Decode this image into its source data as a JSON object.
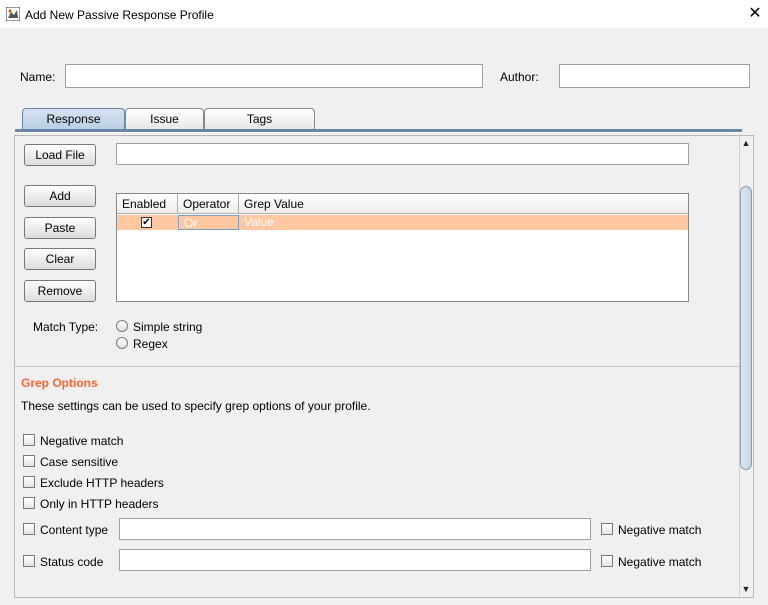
{
  "window": {
    "title": "Add New Passive Response Profile",
    "close_glyph": "✕",
    "icon": "burp-app-icon"
  },
  "header": {
    "name_label": "Name:",
    "name_value": "",
    "author_label": "Author:",
    "author_value": ""
  },
  "tabs": [
    {
      "label": "Response",
      "active": true
    },
    {
      "label": "Issue",
      "active": false
    },
    {
      "label": "Tags",
      "active": false
    }
  ],
  "response": {
    "load_file_label": "Load File",
    "load_file_path": "",
    "buttons": {
      "add": "Add",
      "paste": "Paste",
      "clear": "Clear",
      "remove": "Remove"
    },
    "table": {
      "columns": [
        "Enabled",
        "Operator",
        "Grep Value"
      ],
      "rows": [
        {
          "enabled": true,
          "operator": "Or",
          "grep_value": "Value"
        }
      ],
      "selected_row_color": "#ffc8a0"
    },
    "match_type": {
      "label": "Match Type:",
      "options": [
        "Simple string",
        "Regex"
      ],
      "selected": ""
    }
  },
  "grep_options": {
    "title": "Grep Options",
    "title_color": "#ff6633",
    "description": "These settings can be used to specify grep options of your profile.",
    "checkboxes": [
      {
        "label": "Negative match",
        "checked": false
      },
      {
        "label": "Case sensitive",
        "checked": false
      },
      {
        "label": "Exclude HTTP headers",
        "checked": false
      },
      {
        "label": "Only in HTTP headers",
        "checked": false
      }
    ],
    "content_type": {
      "label": "Content type",
      "value": "",
      "negative_label": "Negative match",
      "negative_checked": false
    },
    "status_code": {
      "label": "Status code",
      "value": "",
      "negative_label": "Negative match",
      "negative_checked": false
    }
  },
  "scrollbar": {
    "up_glyph": "▲",
    "down_glyph": "▼"
  }
}
